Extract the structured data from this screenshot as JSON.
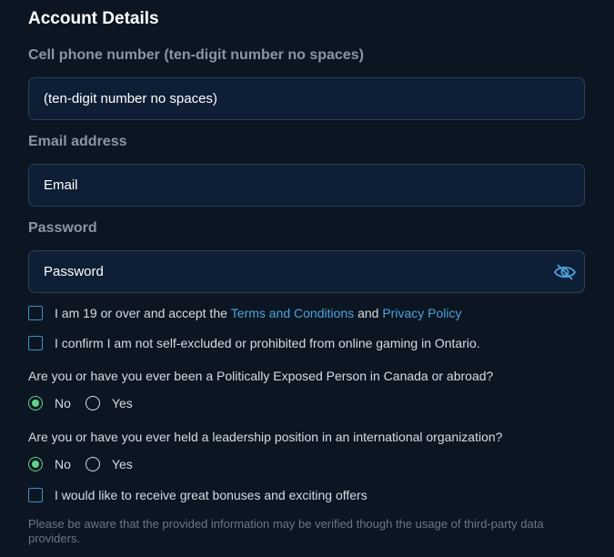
{
  "section": {
    "title": "Account Details"
  },
  "phone": {
    "label": "Cell phone number (ten-digit number no spaces)",
    "placeholder": "(ten-digit number no spaces)"
  },
  "email": {
    "label": "Email address",
    "placeholder": "Email"
  },
  "password": {
    "label": "Password",
    "placeholder": "Password",
    "toggle_icon": "eye-slash-icon"
  },
  "checkboxes": {
    "terms": {
      "prefix": "I am 19 or over and accept the ",
      "terms_link": "Terms and Conditions",
      "middle": " and ",
      "privacy_link": "Privacy Policy"
    },
    "self_excluded": "I confirm I am not self-excluded or prohibited from online gaming in Ontario.",
    "offers": "I would like to receive great bonuses and exciting offers"
  },
  "questions": {
    "pep": {
      "text": "Are you or have you ever been a Politically Exposed Person in Canada or abroad?",
      "no": "No",
      "yes": "Yes",
      "selected": "No"
    },
    "leadership": {
      "text": "Are you or have you ever held a leadership position in an international organization?",
      "no": "No",
      "yes": "Yes",
      "selected": "No"
    }
  },
  "notice": "Please be aware that the provided information may be verified though the usage of third-party data providers.",
  "colors": {
    "background": "#0c1622",
    "input_bg": "#0e1f35",
    "link": "#4aa3dc",
    "radio_selected": "#5ed48a",
    "checkbox_border": "#3f8fc9"
  }
}
